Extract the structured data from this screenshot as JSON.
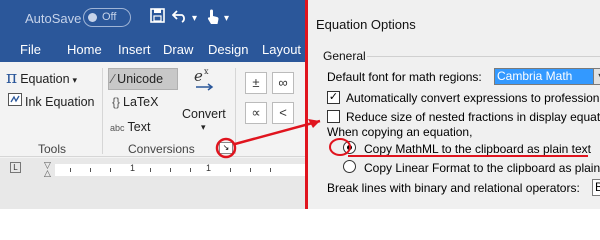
{
  "word": {
    "autosave_label": "AutoSave",
    "autosave_state": "Off",
    "tabs": [
      "File",
      "Home",
      "Insert",
      "Draw",
      "Design",
      "Layout"
    ],
    "tools": {
      "equation_label": "Equation",
      "ink_equation_label": "Ink Equation",
      "group_label": "Tools"
    },
    "conversions": {
      "unicode_label": "Unicode",
      "latex_label": "LaTeX",
      "text_label": "Text",
      "convert_label": "Convert",
      "group_label": "Conversions"
    },
    "symbols": [
      "±",
      "∞",
      "∝",
      "<"
    ],
    "ruler_numbers": [
      "1",
      "1"
    ]
  },
  "dialog": {
    "title": "Equation Options",
    "section_general": "General",
    "default_font_label": "Default font for math regions:",
    "default_font_value": "Cambria Math",
    "auto_convert_label": "Automatically convert expressions to professiona",
    "auto_convert_checked": true,
    "reduce_size_label": "Reduce size of nested fractions in display equatio",
    "reduce_size_checked": false,
    "copying_label": "When copying an equation,",
    "copy_mathml_label": "Copy MathML to the clipboard as plain text",
    "copy_linear_label": "Copy Linear Format to the clipboard as plain text",
    "break_lines_label": "Break lines with binary and relational operators:",
    "break_lines_value": "Be"
  },
  "colors": {
    "titlebar": "#2b579a",
    "annotation": "#e0141e",
    "selection": "#3399ff"
  }
}
